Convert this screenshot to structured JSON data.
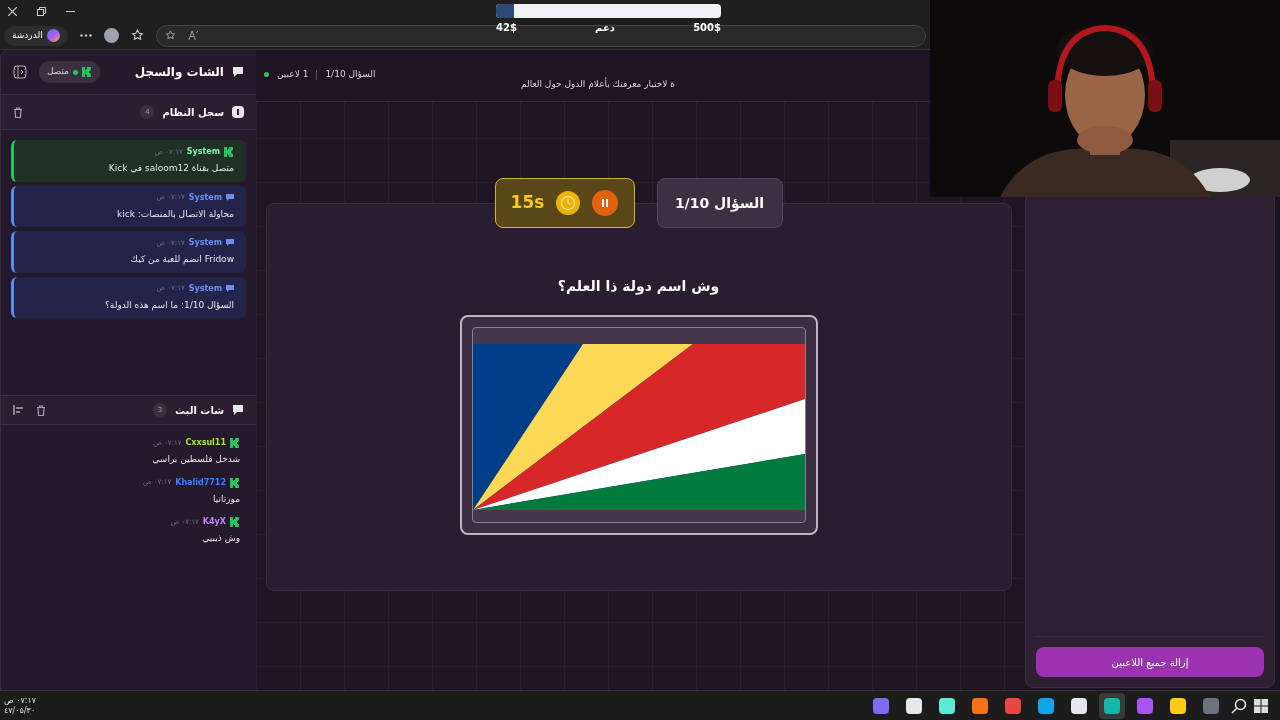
{
  "donation": {
    "raised": "42$",
    "label": "دعم",
    "goal": "500$",
    "level": 0.08
  },
  "browser": {
    "chat_button": "الدردشة"
  },
  "sidebar": {
    "title": "الشات والسجل",
    "status": "متصل",
    "connected": true,
    "system_log": {
      "title": "سجل النظام",
      "count": "4",
      "entries": [
        {
          "kind": "kick",
          "author": "System",
          "time": "٠٧:١٧ ص",
          "text": "متصل بقناة saloom12 في Kick"
        },
        {
          "kind": "system",
          "author": "System",
          "time": "٠٧:١٧ ص",
          "text": "محاولة الاتصال بالمنصات: kick"
        },
        {
          "kind": "system",
          "author": "System",
          "time": "٠٧:١٧ ص",
          "text": "Fridow انضم للعبة من كيك"
        },
        {
          "kind": "system",
          "author": "System",
          "time": "٠٧:١٧ ص",
          "text": "السؤال 1/10: ما اسم هذه الدولة؟"
        }
      ]
    },
    "stream_chat": {
      "title": "شات البث",
      "count": "3",
      "messages": [
        {
          "user": "Cxxsul11",
          "color": "#a3e635",
          "time": "٠٧:١٧ ص",
          "text": "شدخل فلسطين براسي"
        },
        {
          "user": "Khalid7712",
          "color": "#3b82f6",
          "time": "٠٧:١٧ ص",
          "text": "مورتانيا"
        },
        {
          "user": "K4yX",
          "color": "#c084fc",
          "time": "٠٧:١٧ ص",
          "text": "وش ذيبيي"
        }
      ]
    }
  },
  "header": {
    "players": "1 لاعبين",
    "question": "السؤال 1/10",
    "description": "ة لاختبار معرفتك بأعلام الدول حول العالم"
  },
  "quiz": {
    "question_label": "السؤال 1/10",
    "timer": "15s",
    "paused": false,
    "prompt": "وش اسم دولة ذا العلم؟"
  },
  "players_panel": {
    "button": "إزالة جميع اللاعبين"
  },
  "taskbar": {
    "time": "٠٧:١٧ ص",
    "date": "٤٧/٠٥/٣٠"
  }
}
